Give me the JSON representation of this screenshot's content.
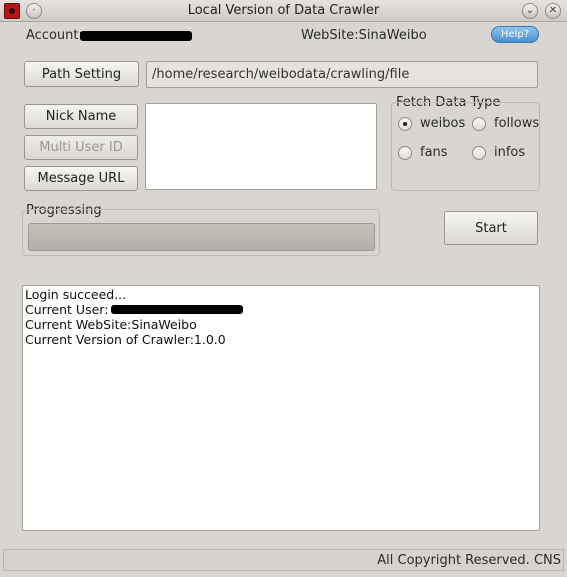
{
  "window": {
    "title": "Local Version of Data Crawler",
    "minimize_glyph": "⌄",
    "close_glyph": "✕",
    "menu_glyph": "·"
  },
  "header": {
    "account_label": "Account:",
    "website_label": "WebSite:SinaWeibo",
    "help_label": "Help?"
  },
  "path": {
    "button_label": "Path Setting",
    "value": "/home/research/weibodata/crawling/file"
  },
  "input_mode": {
    "nick_name_label": "Nick Name",
    "multi_user_id_label": "Multi User ID",
    "message_url_label": "Message URL",
    "input_value": ""
  },
  "fetch_type": {
    "title": "Fetch Data Type",
    "options": [
      {
        "label": "weibos",
        "checked": true
      },
      {
        "label": "follows",
        "checked": false
      },
      {
        "label": "fans",
        "checked": false
      },
      {
        "label": "infos",
        "checked": false
      }
    ]
  },
  "progress": {
    "title": "Progressing",
    "value": 0
  },
  "actions": {
    "start_label": "Start"
  },
  "log": {
    "lines": [
      "Login succeed...",
      "Current User:",
      "Current WebSite:SinaWeibo",
      "Current Version of Crawler:1.0.0"
    ]
  },
  "status": {
    "text": "All Copyright Reserved. CNS"
  },
  "colors": {
    "window_bg": "#d9d6d1",
    "help_accent": "#4a8fd0",
    "redaction": "#000000"
  }
}
